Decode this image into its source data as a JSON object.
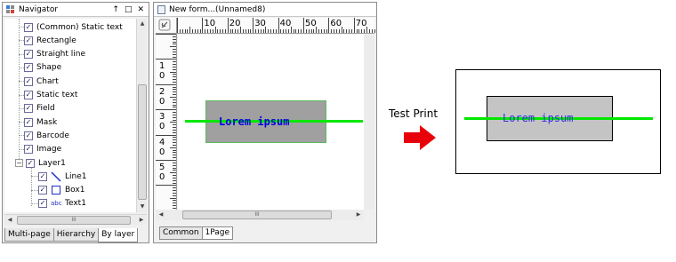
{
  "navigator": {
    "title": "Navigator",
    "title_buttons": {
      "pin": "↑",
      "float": "□",
      "close": "✕"
    },
    "items": [
      {
        "label": "(Common) Static text",
        "checked": true
      },
      {
        "label": "Rectangle",
        "checked": true
      },
      {
        "label": "Straight line",
        "checked": true
      },
      {
        "label": "Shape",
        "checked": true
      },
      {
        "label": "Chart",
        "checked": true
      },
      {
        "label": "Static text",
        "checked": true
      },
      {
        "label": "Field",
        "checked": true
      },
      {
        "label": "Mask",
        "checked": true
      },
      {
        "label": "Barcode",
        "checked": true
      },
      {
        "label": "Image",
        "checked": true
      }
    ],
    "layer": {
      "label": "Layer1",
      "expander": "−",
      "checked": true
    },
    "layer_children": [
      {
        "label": "Line1",
        "icon": "line-icon",
        "checked": true
      },
      {
        "label": "Box1",
        "icon": "box-icon",
        "checked": true
      },
      {
        "label": "Text1",
        "icon": "text-icon",
        "icon_text": "abc",
        "checked": true
      }
    ],
    "check_glyph": "✓",
    "scroll_grip": "III",
    "tabs": [
      {
        "label": "Multi-page",
        "active": false
      },
      {
        "label": "Hierarchy",
        "active": false
      },
      {
        "label": "By layer",
        "active": true
      }
    ]
  },
  "form": {
    "title": "New form...(Unnamed8)",
    "ruler_top_labels": [
      "10",
      "20",
      "30",
      "40",
      "50",
      "60",
      "70"
    ],
    "ruler_left_labels": [
      [
        "1",
        "0"
      ],
      [
        "2",
        "0"
      ],
      [
        "3",
        "0"
      ],
      [
        "4",
        "0"
      ],
      [
        "5",
        "0"
      ]
    ],
    "lorem_text": "Lorem ipsum",
    "scroll_grip": "III",
    "tabs": [
      {
        "label": "Common",
        "active": false
      },
      {
        "label": "1Page",
        "active": true
      }
    ]
  },
  "test_print": {
    "label": "Test Print",
    "arrow_color": "#e8000a",
    "lorem_text": "Lorem ipsum"
  },
  "colors": {
    "accent_line": "#00e800",
    "text_blue": "#0000e0",
    "box_fill": "#a0a0a0"
  }
}
